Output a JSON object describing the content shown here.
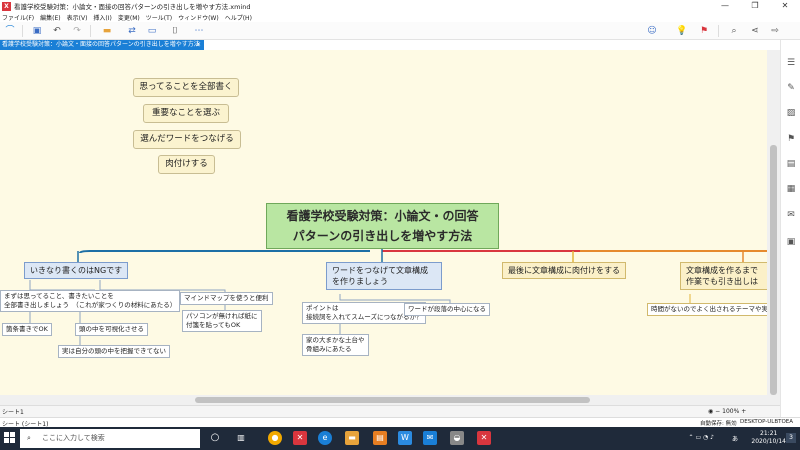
{
  "window": {
    "title": "看護学校受験対策：小論文・面接の回答パターンの引き出しを増やす方法.xmind",
    "logo_text": "X",
    "minimize": "—",
    "maximize": "❐",
    "close": "✕"
  },
  "menu": [
    "ファイル(F)",
    "編集(E)",
    "表示(V)",
    "挿入(I)",
    "変更(M)",
    "ツール(T)",
    "ウィンドウ(W)",
    "ヘルプ(H)"
  ],
  "toolbar": {
    "icons": [
      "mindmap-icon",
      "save-icon",
      "undo-icon",
      "redo-icon",
      "folder-icon",
      "relationship-icon",
      "boundary-icon",
      "more-icon",
      "marker-icon",
      "idea-icon",
      "flag-icon",
      "zoom-icon",
      "share-icon",
      "export-icon"
    ]
  },
  "tab": {
    "label": "看護学校受験対策：小論文・面接の回答パターンの引き出しを増やす方法",
    "close": "✕"
  },
  "map": {
    "floating": [
      "思ってることを全部書く",
      "重要なことを選ぶ",
      "選んだワードをつなげる",
      "肉付けする"
    ],
    "central_line1": "看護学校受験対策：小論文・の回答",
    "central_line2": "パターンの引き出しを増やす方法",
    "branches": [
      {
        "label": "いきなり書くのはNGです"
      },
      {
        "label_line1": "ワードをつなげて文章構成",
        "label_line2": "を作りましょう"
      },
      {
        "label": "最後に文章構成に肉付けをする"
      },
      {
        "label_line1": "文章構成を作るまで",
        "label_line2": "作業でも引き出しは"
      }
    ],
    "b1_sub": {
      "a_line1": "まずは思ってること、書きたいことを",
      "a_line2": "全部書き出しましょう　（これが家つくりの材料にあたる）",
      "b": "マインドマップを使うと便利",
      "c_line1": "パソコンが無ければ紙に",
      "c_line2": "付箋を貼ってもOK",
      "d": "箇条書きでOK",
      "e": "頭の中を可視化させる",
      "f": "実は自分の頭の中を把握できてない"
    },
    "b2_sub": {
      "a_line1": "ポイントは",
      "a_line2": "接続詞を入れてスムーズにつながるか？",
      "b": "ワードが段落の中心になる",
      "c_line1": "家の大まかな土台や",
      "c_line2": "骨組みにあたる"
    },
    "b4_sub": {
      "a": "時間がないのでよく出されるテーマや実"
    }
  },
  "status": {
    "sheet_tab": "シート1",
    "sheet_label": "シート (シート1)",
    "auto_save": "自動保存: 無効",
    "computer": "DESKTOP-ULBTOEA",
    "zoom": "100%",
    "zoom_minus": "−",
    "zoom_plus": "+"
  },
  "taskbar": {
    "search_placeholder": "ここに入力して検索",
    "time": "21:21",
    "date": "2020/10/14",
    "ime": "あ",
    "notification_count": "3"
  },
  "colors": {
    "accent": "#1a7fd6",
    "canvas": "#fefae4",
    "central": "#b9e6a2",
    "branch_line_blue": "#1d6fa5",
    "branch_line_red": "#d9363e",
    "taskbar": "#1f2a3a"
  }
}
